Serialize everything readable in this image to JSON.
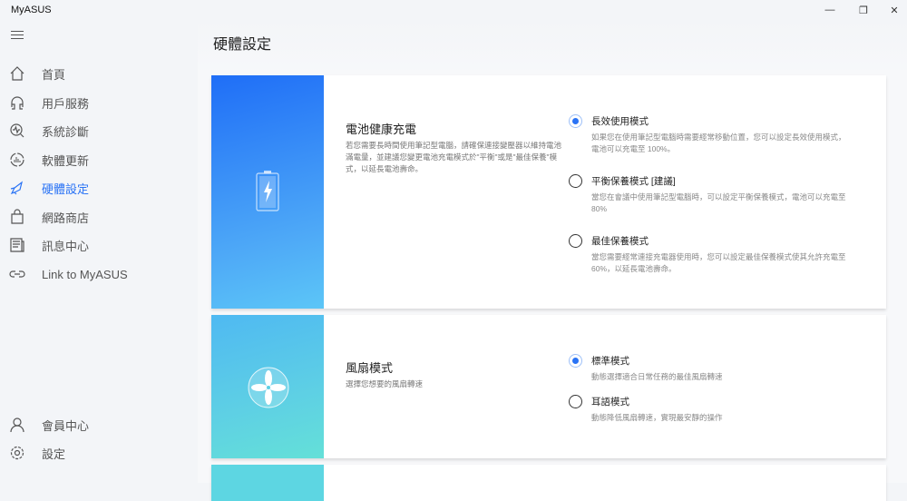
{
  "app": {
    "title": "MyASUS"
  },
  "window": {
    "minimize": "—",
    "restore": "❐",
    "close": "✕"
  },
  "sidebar": {
    "items": [
      {
        "label": "首頁",
        "icon": "home-icon"
      },
      {
        "label": "用戶服務",
        "icon": "headset-icon"
      },
      {
        "label": "系統診斷",
        "icon": "diagnosis-icon"
      },
      {
        "label": "軟體更新",
        "icon": "update-icon"
      },
      {
        "label": "硬體設定",
        "icon": "rocket-icon",
        "active": true
      },
      {
        "label": "網路商店",
        "icon": "shopping-bag-icon"
      },
      {
        "label": "訊息中心",
        "icon": "news-icon"
      },
      {
        "label": "Link to MyASUS",
        "icon": "link-icon"
      }
    ],
    "bottom": [
      {
        "label": "會員中心",
        "icon": "user-icon"
      },
      {
        "label": "設定",
        "icon": "gear-icon"
      }
    ]
  },
  "main": {
    "title": "硬體設定",
    "battery": {
      "title": "電池健康充電",
      "desc": "若您需要長時間使用筆記型電腦，請確保連接變壓器以維持電池滿電量，並建議您變更電池充電模式於\"平衡\"或是\"最佳保養\"模式，以延長電池壽命。",
      "options": [
        {
          "label": "長效使用模式",
          "desc": "如果您在使用筆記型電腦時需要經常移動位置，您可以設定長效使用模式，電池可以充電至 100%。",
          "selected": true
        },
        {
          "label": "平衡保養模式 [建議]",
          "desc": "當您在會議中使用筆記型電腦時，可以設定平衡保養模式，電池可以充電至 80%",
          "selected": false
        },
        {
          "label": "最佳保養模式",
          "desc": "當您需要經常連接充電器使用時，您可以設定最佳保養模式使其允許充電至60%，以延長電池壽命。",
          "selected": false
        }
      ]
    },
    "fan": {
      "title": "風扇模式",
      "desc": "選擇您想要的風扇轉速",
      "options": [
        {
          "label": "標準模式",
          "desc": "動態選擇適合日常任務的最佳風扇轉速",
          "selected": true
        },
        {
          "label": "耳語模式",
          "desc": "動態降低風扇轉速，實現最安靜的操作",
          "selected": false
        }
      ]
    }
  },
  "colors": {
    "accent": "#2a73f5"
  }
}
